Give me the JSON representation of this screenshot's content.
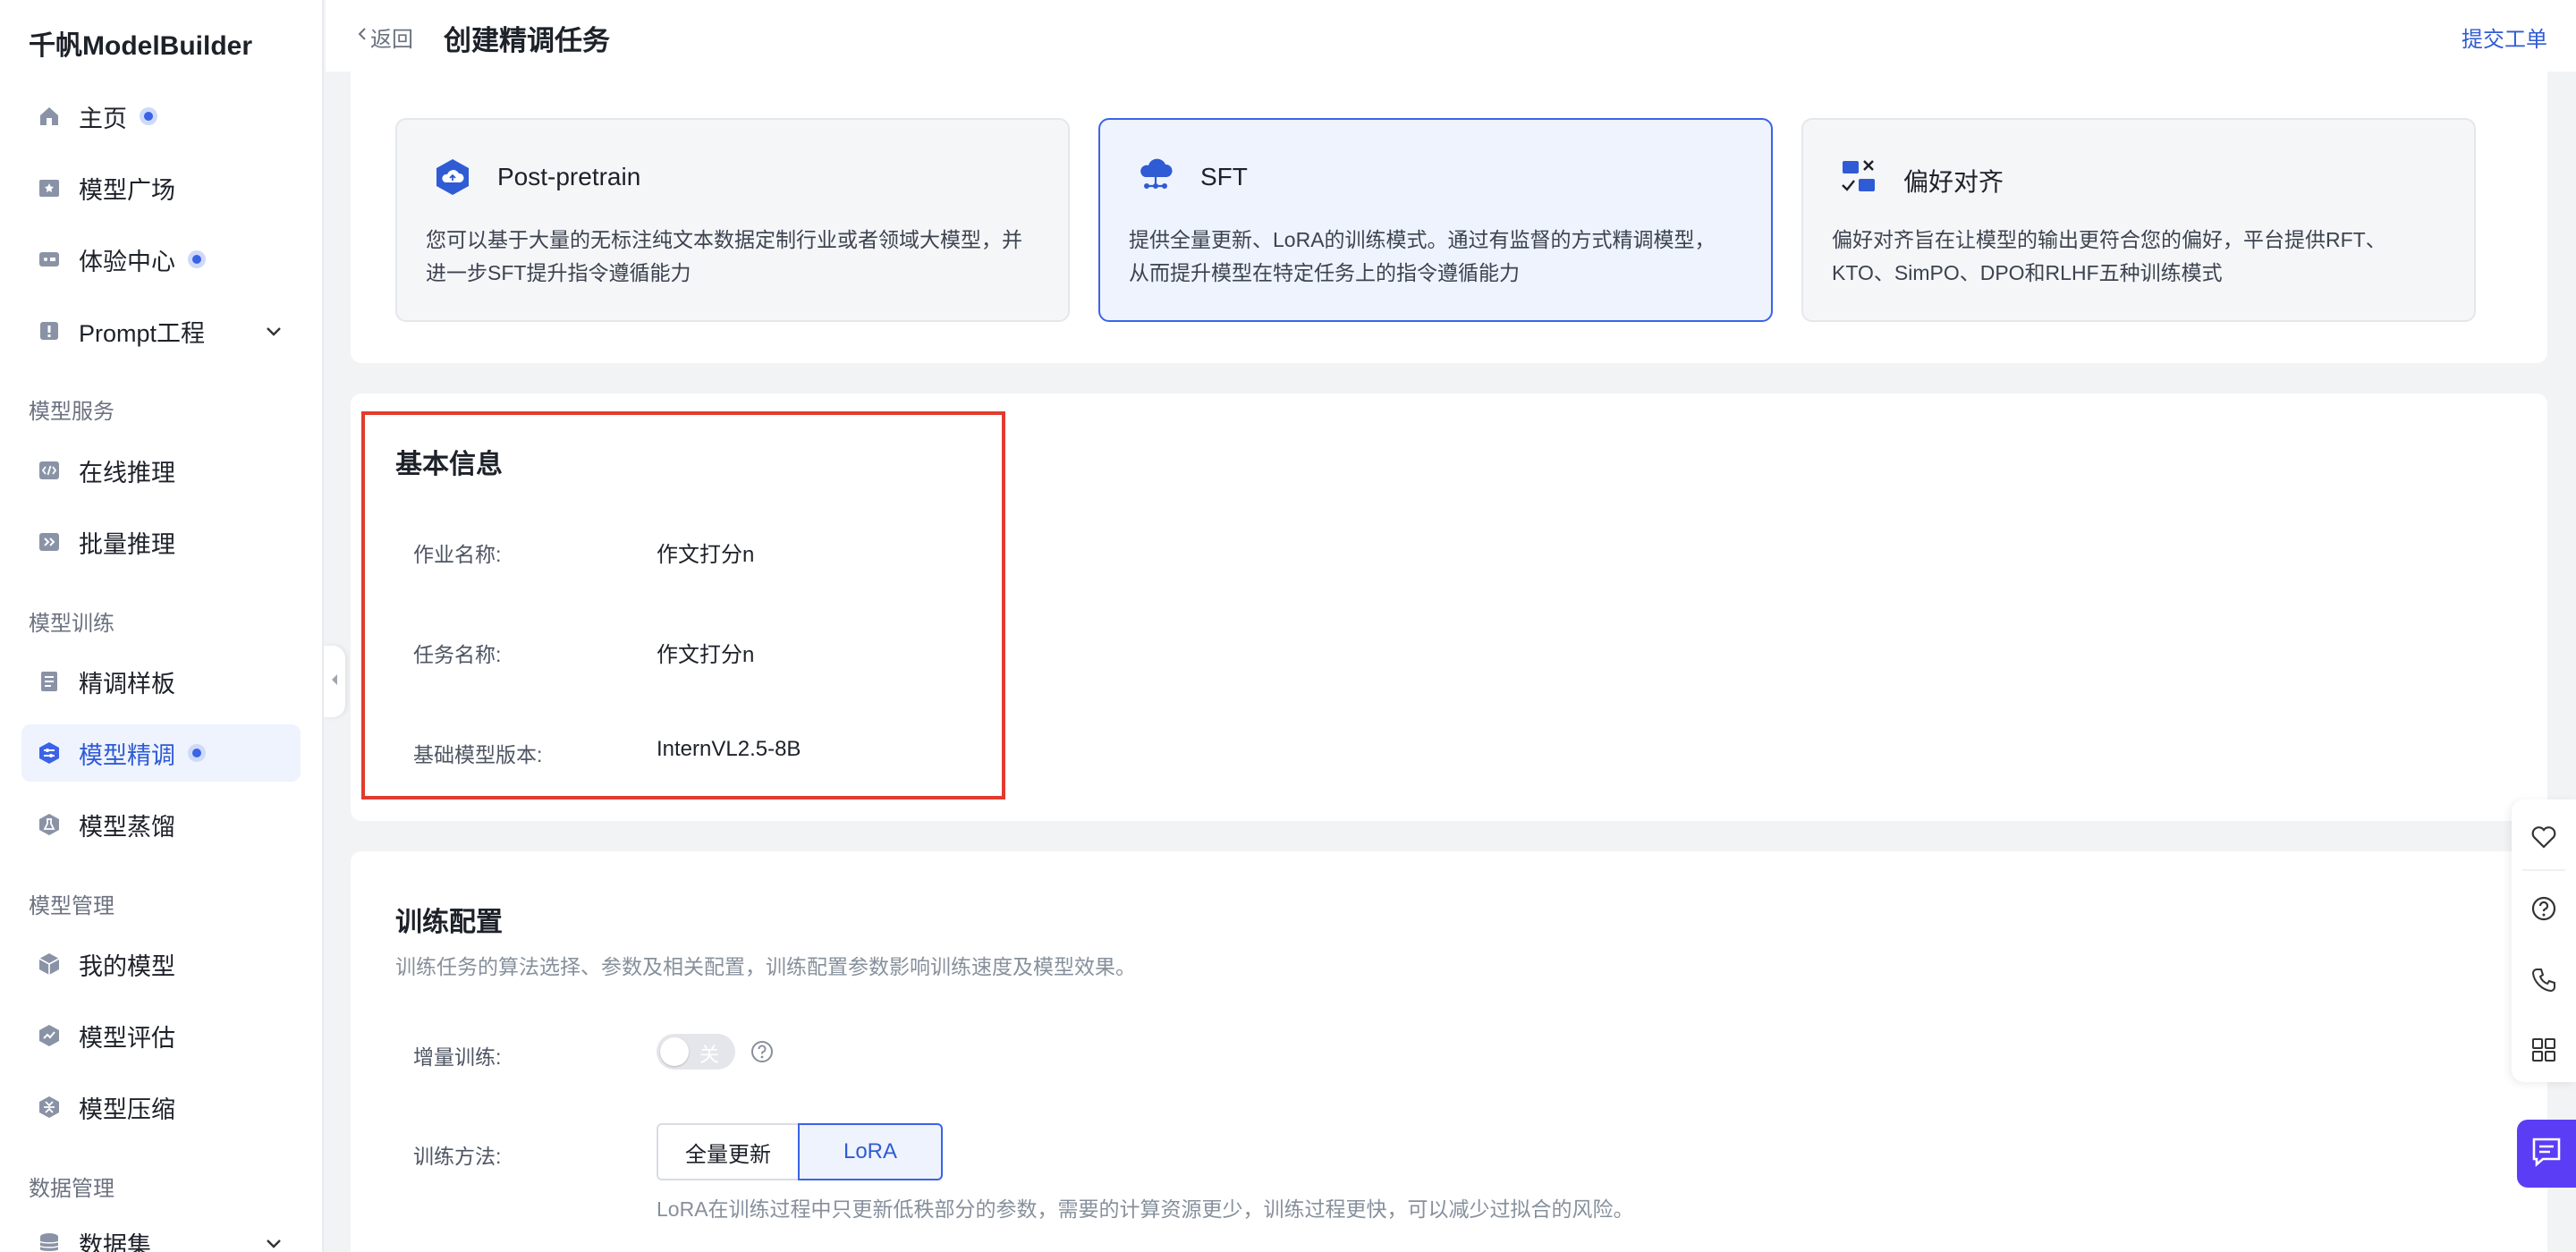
{
  "brand": "千帆ModelBuilder",
  "sidebar": {
    "items": [
      {
        "label": "主页",
        "icon": "home-icon",
        "dot": true
      },
      {
        "label": "模型广场",
        "icon": "model-square-icon",
        "dot": false
      },
      {
        "label": "体验中心",
        "icon": "experience-icon",
        "dot": true
      },
      {
        "label": "Prompt工程",
        "icon": "prompt-icon",
        "dot": false,
        "expandable": true
      }
    ],
    "groups": [
      {
        "title": "模型服务",
        "items": [
          {
            "label": "在线推理",
            "icon": "code-icon"
          },
          {
            "label": "批量推理",
            "icon": "batch-icon"
          }
        ]
      },
      {
        "title": "模型训练",
        "items": [
          {
            "label": "精调样板",
            "icon": "book-icon"
          },
          {
            "label": "模型精调",
            "icon": "finetune-icon",
            "active": true,
            "dot": true
          },
          {
            "label": "模型蒸馏",
            "icon": "distill-icon"
          }
        ]
      },
      {
        "title": "模型管理",
        "items": [
          {
            "label": "我的模型",
            "icon": "cube-icon"
          },
          {
            "label": "模型评估",
            "icon": "chart-icon"
          },
          {
            "label": "模型压缩",
            "icon": "compress-icon"
          }
        ]
      },
      {
        "title": "数据管理",
        "items": [
          {
            "label": "数据集",
            "icon": "database-icon",
            "expandable": true
          }
        ]
      }
    ]
  },
  "header": {
    "back": "返回",
    "title": "创建精调任务",
    "submit": "提交工单"
  },
  "types": [
    {
      "title": "Post-pretrain",
      "desc": "您可以基于大量的无标注纯文本数据定制行业或者领域大模型，并进一步SFT提升指令遵循能力",
      "selected": false
    },
    {
      "title": "SFT",
      "desc": "提供全量更新、LoRA的训练模式。通过有监督的方式精调模型，从而提升模型在特定任务上的指令遵循能力",
      "selected": true
    },
    {
      "title": "偏好对齐",
      "desc": "偏好对齐旨在让模型的输出更符合您的偏好，平台提供RFT、KTO、SimPO、DPO和RLHF五种训练模式",
      "selected": false
    }
  ],
  "basic_info": {
    "title": "基本信息",
    "fields": [
      {
        "label": "作业名称:",
        "value": "作文打分n"
      },
      {
        "label": "任务名称:",
        "value": "作文打分n"
      },
      {
        "label": "基础模型版本:",
        "value": "InternVL2.5-8B"
      }
    ]
  },
  "training": {
    "title": "训练配置",
    "subtitle": "训练任务的算法选择、参数及相关配置，训练配置参数影响训练速度及模型效果。",
    "incremental_label": "增量训练:",
    "toggle_text": "关",
    "toggle_on": false,
    "method_label": "训练方法:",
    "methods": [
      "全量更新",
      "LoRA"
    ],
    "selected_method": "LoRA",
    "method_hint": "LoRA在训练过程中只更新低秩部分的参数，需要的计算资源更少，训练过程更快，可以减少过拟合的风险。"
  },
  "colors": {
    "accent": "#3b63e8",
    "highlight": "#e23b2e",
    "chat": "#5b3df5"
  }
}
